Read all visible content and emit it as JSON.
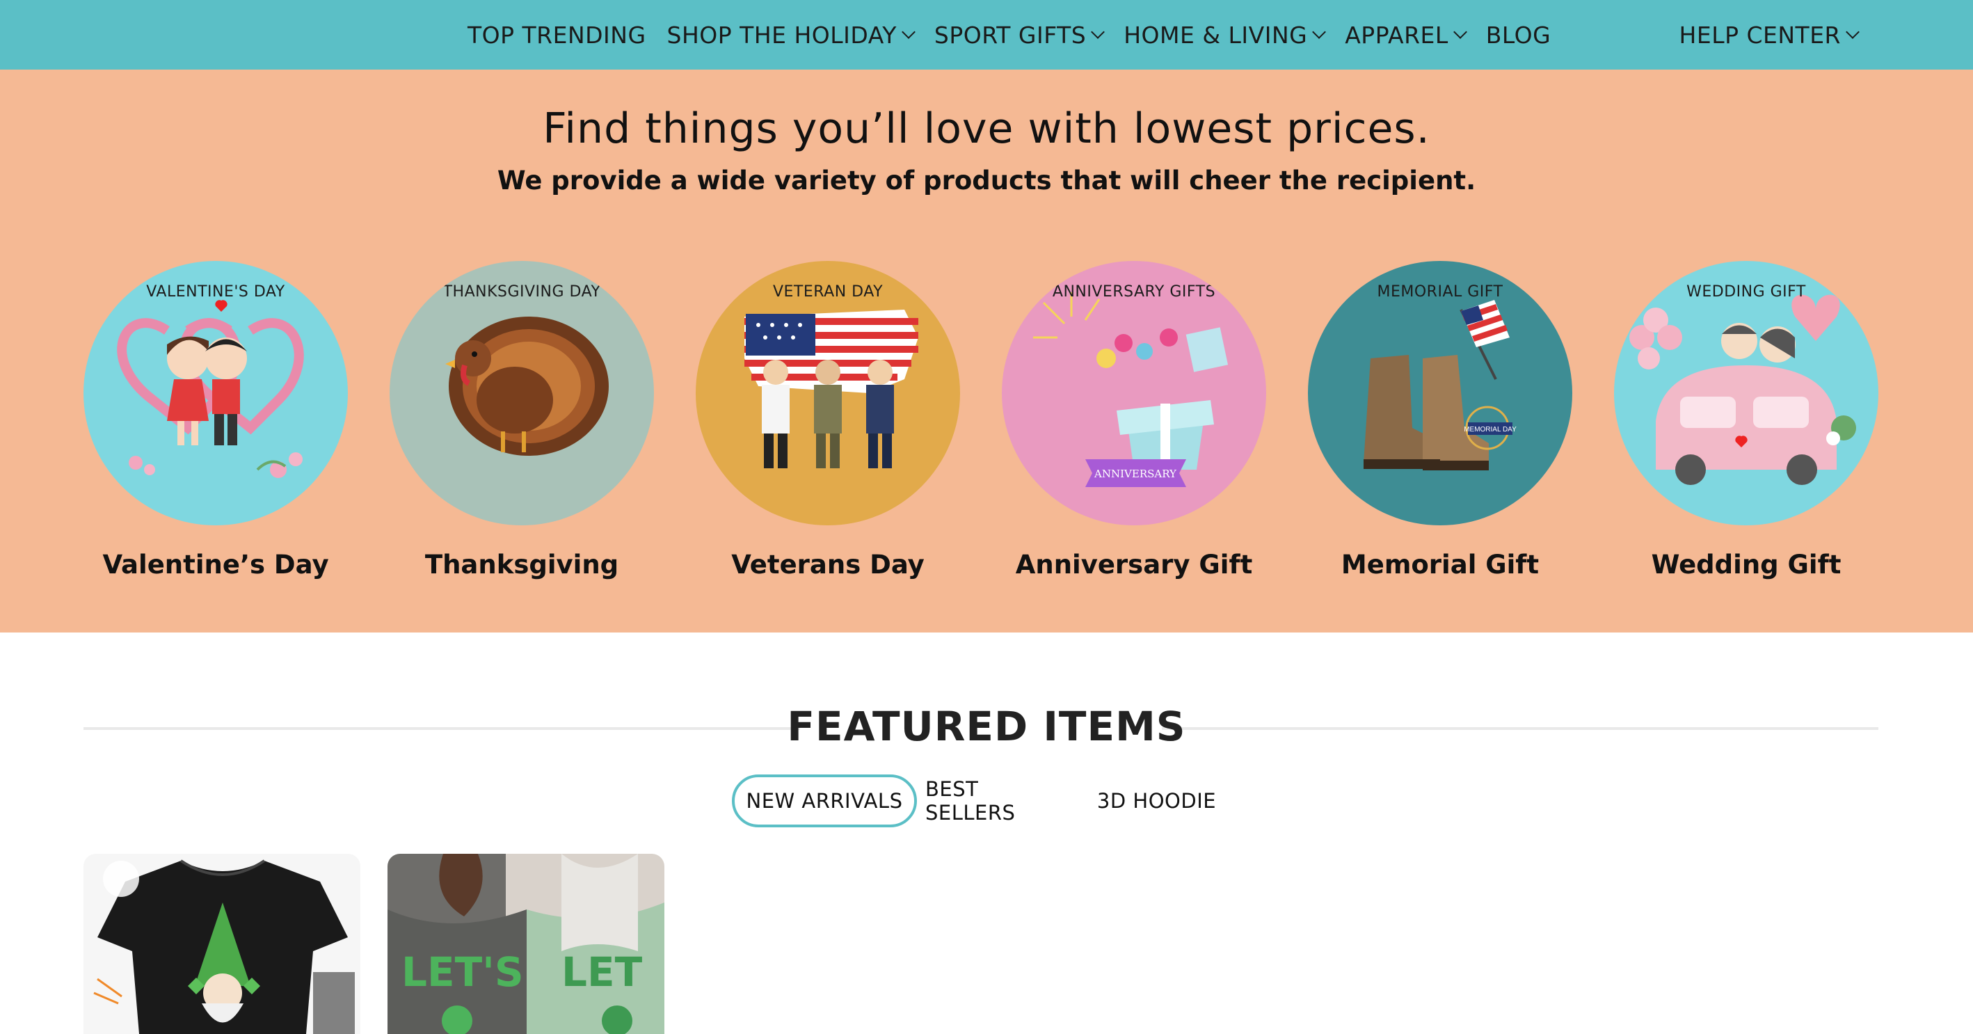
{
  "nav": {
    "items": [
      {
        "label": "TOP TRENDING",
        "dropdown": false
      },
      {
        "label": "SHOP THE HOLIDAY",
        "dropdown": true
      },
      {
        "label": "SPORT GIFTS",
        "dropdown": true
      },
      {
        "label": "HOME & LIVING",
        "dropdown": true
      },
      {
        "label": "APPAREL",
        "dropdown": true
      },
      {
        "label": "BLOG",
        "dropdown": false
      }
    ],
    "help": {
      "label": "HELP CENTER",
      "dropdown": true
    }
  },
  "hero": {
    "title": "Find things you’ll love with lowest prices.",
    "subtitle": "We provide a wide variety of products that will cheer the recipient."
  },
  "categories": [
    {
      "tag": "VALENTINE'S DAY",
      "title": "Valentine’s Day",
      "bg": "#7fd7e0",
      "icon": "valentine-couple-icon"
    },
    {
      "tag": "THANKSGIVING DAY",
      "title": "Thanksgiving",
      "bg": "#a9c2b8",
      "icon": "turkey-icon"
    },
    {
      "tag": "VETERAN DAY",
      "title": "Veterans Day",
      "bg": "#e2aa4b",
      "icon": "veterans-flag-icon"
    },
    {
      "tag": "ANNIVERSARY GIFTS",
      "title": "Anniversary Gift",
      "bg": "#e99ac0",
      "icon": "gift-box-icon",
      "banner": "ANNIVERSARY"
    },
    {
      "tag": "MEMORIAL GIFT",
      "title": "Memorial Gift",
      "bg": "#3e8d94",
      "icon": "boots-flag-icon",
      "badge": "MEMORIAL DAY"
    },
    {
      "tag": "WEDDING GIFT",
      "title": "Wedding Gift",
      "bg": "#7fd7e0",
      "icon": "wedding-car-icon"
    }
  ],
  "featured": {
    "title": "FEATURED ITEMS",
    "tabs": [
      {
        "label": "NEW ARRIVALS",
        "active": true
      },
      {
        "label": "BEST SELLERS",
        "active": false
      },
      {
        "label": "3D HOODIE",
        "active": false
      }
    ],
    "products": [
      {
        "image": "gnome-tshirt-image"
      },
      {
        "image": "lets-day-shirts-image"
      }
    ]
  },
  "colors": {
    "nav_bg": "#5bbfc6",
    "hero_bg": "#f5b994",
    "accent": "#5bbfc6"
  }
}
